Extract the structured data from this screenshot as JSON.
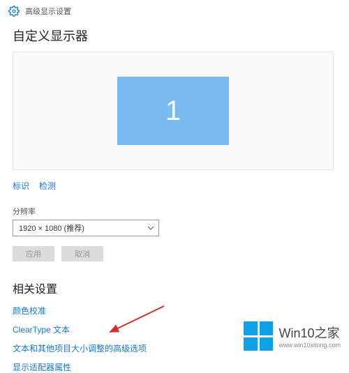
{
  "header": {
    "title": "高级显示设置"
  },
  "main": {
    "customize_title": "自定义显示器",
    "monitor_number": "1",
    "identify_link": "标识",
    "detect_link": "检测",
    "resolution_label": "分辨率",
    "resolution_value": "1920 × 1080 (推荐)",
    "apply_label": "应用",
    "cancel_label": "取消"
  },
  "related": {
    "title": "相关设置",
    "color_calibration": "颜色校准",
    "cleartype": "ClearType 文本",
    "advanced_sizing": "文本和其他项目大小调整的高级选项",
    "adapter_properties": "显示适配器属性"
  },
  "watermark": {
    "title": "Win10之家",
    "url": "www.win10xitong.com"
  }
}
